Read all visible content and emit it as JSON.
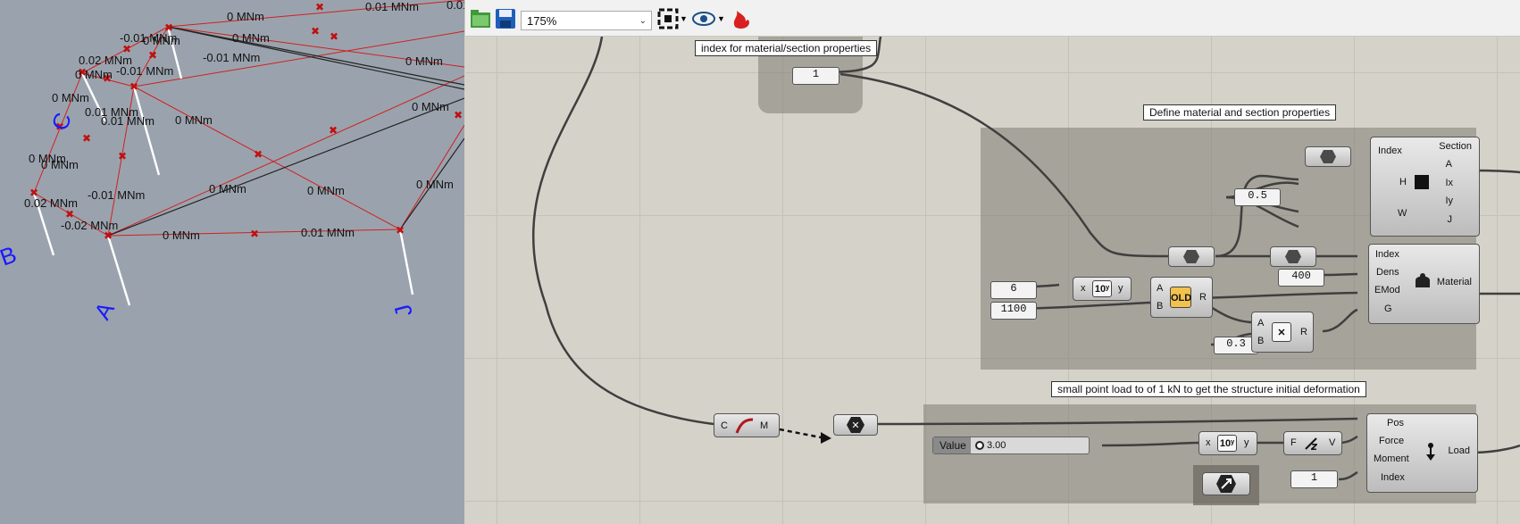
{
  "viewport": {
    "moment_labels": [
      "0 MNm",
      "0.01 MNm",
      "0.01",
      "-0.01 MNm",
      "0 MNm",
      "0.02 MNm",
      "0 MNm",
      "-0.01 MNm",
      "-0.01 MNm",
      "0 MNm",
      "0 MNm",
      "0 MNm",
      "0.01 MNm",
      "0.01 MNm",
      "0 MNm",
      "0 MNm",
      "0 MNm",
      "0 MNm",
      "0.02 MNm",
      "-0.01 MNm",
      "0 MNm",
      "0 MNm",
      "-0.02 MNm",
      "0 MNm",
      "0.01 MNm",
      "0 MNm"
    ],
    "axis_letters": [
      "B",
      "C",
      "A",
      "J"
    ]
  },
  "toolbar": {
    "zoom_value": "175%",
    "zoom_dropdown_icon": "chevron-down-icon"
  },
  "canvas": {
    "tags": {
      "index_tag": "index for material/section properties",
      "material_group_tag": "Define material and section properties",
      "load_group_tag": "small point load to of 1 kN to get the structure initial deformation"
    },
    "panels": {
      "index_value": "1",
      "height_value": "0.5",
      "density_value": "400",
      "a_value": "6",
      "b_value": "1100",
      "poisson_value": "0.3",
      "load_index_value": "1"
    },
    "section_component": {
      "inputs": [
        "Index",
        "H",
        "W"
      ],
      "outputs": [
        "Section",
        "A",
        "Ix",
        "Iy",
        "J"
      ]
    },
    "material_component": {
      "inputs": [
        "Index",
        "Dens",
        "EMod",
        "G"
      ],
      "output": "Material"
    },
    "load_component": {
      "inputs": [
        "Pos",
        "Force",
        "Moment",
        "Index"
      ],
      "output": "Load"
    },
    "pow_component_1": {
      "x": "x",
      "y": "y"
    },
    "pow_component_2": {
      "x": "x",
      "y": "y"
    },
    "mult_component_1": {
      "a": "A",
      "b": "B",
      "r": "R"
    },
    "mult_component_2": {
      "a": "A",
      "b": "B",
      "r": "R"
    },
    "curve_component": {
      "c": "C",
      "m": "M"
    },
    "vector_component": {
      "f": "F",
      "v": "V"
    },
    "slider": {
      "label": "Value",
      "value": "3.00"
    }
  }
}
